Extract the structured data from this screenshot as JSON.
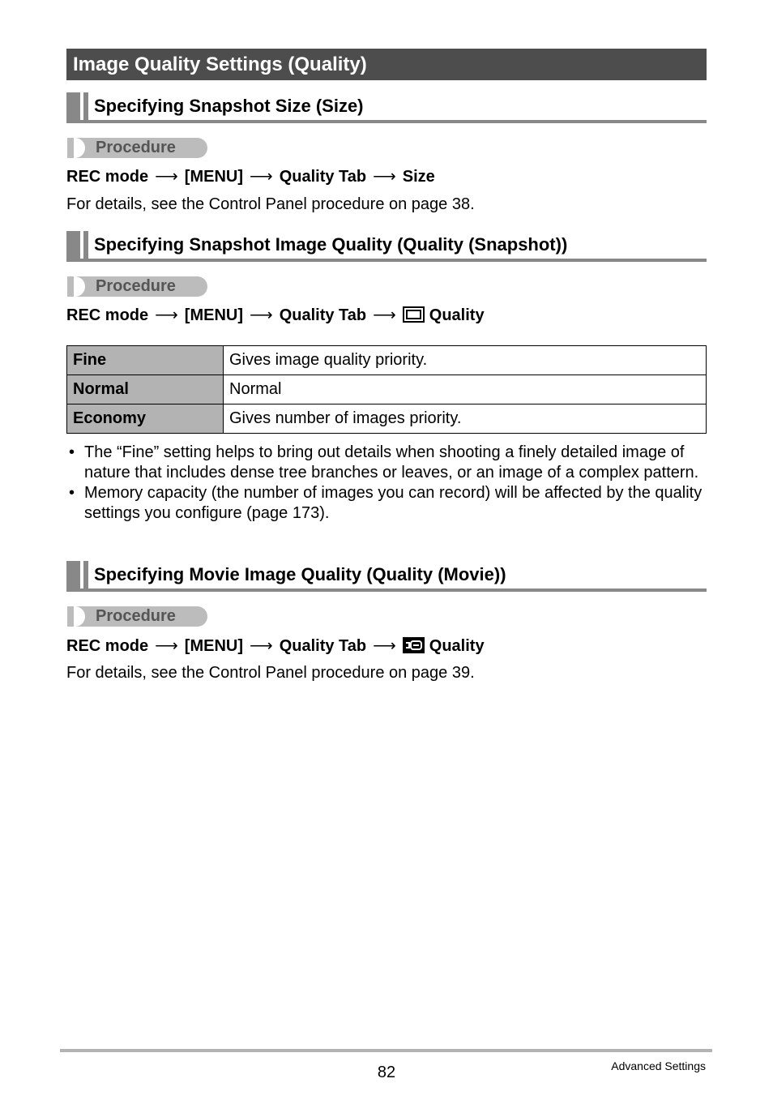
{
  "page_heading": "Image Quality Settings (Quality)",
  "sections": [
    {
      "title": "Specifying Snapshot Size (Size)",
      "procedure_label": "Procedure",
      "path": [
        "REC mode",
        "[MENU]",
        "Quality Tab",
        "Size"
      ],
      "path_icon": null,
      "note": "For details, see the Control Panel procedure on page 38."
    },
    {
      "title": "Specifying Snapshot Image Quality (Quality (Snapshot))",
      "procedure_label": "Procedure",
      "path": [
        "REC mode",
        "[MENU]",
        "Quality Tab",
        "Quality"
      ],
      "path_icon": "snapshot-quality-icon",
      "table": [
        {
          "setting": "Fine",
          "description": "Gives image quality priority."
        },
        {
          "setting": "Normal",
          "description": "Normal"
        },
        {
          "setting": "Economy",
          "description": "Gives number of images priority."
        }
      ],
      "bullets": [
        "The “Fine” setting helps to bring out details when shooting a finely detailed image of nature that includes dense tree branches or leaves, or an image of a complex pattern.",
        "Memory capacity (the number of images you can record) will be affected by the quality settings you configure (page 173)."
      ]
    },
    {
      "title": "Specifying Movie Image Quality (Quality (Movie))",
      "procedure_label": "Procedure",
      "path": [
        "REC mode",
        "[MENU]",
        "Quality Tab",
        "Quality"
      ],
      "path_icon": "movie-quality-icon",
      "note": "For details, see the Control Panel procedure on page 39."
    }
  ],
  "arrow_glyph": "⟶",
  "bullet_glyph": "•",
  "footer": {
    "page_number": "82",
    "section_name": "Advanced Settings"
  }
}
